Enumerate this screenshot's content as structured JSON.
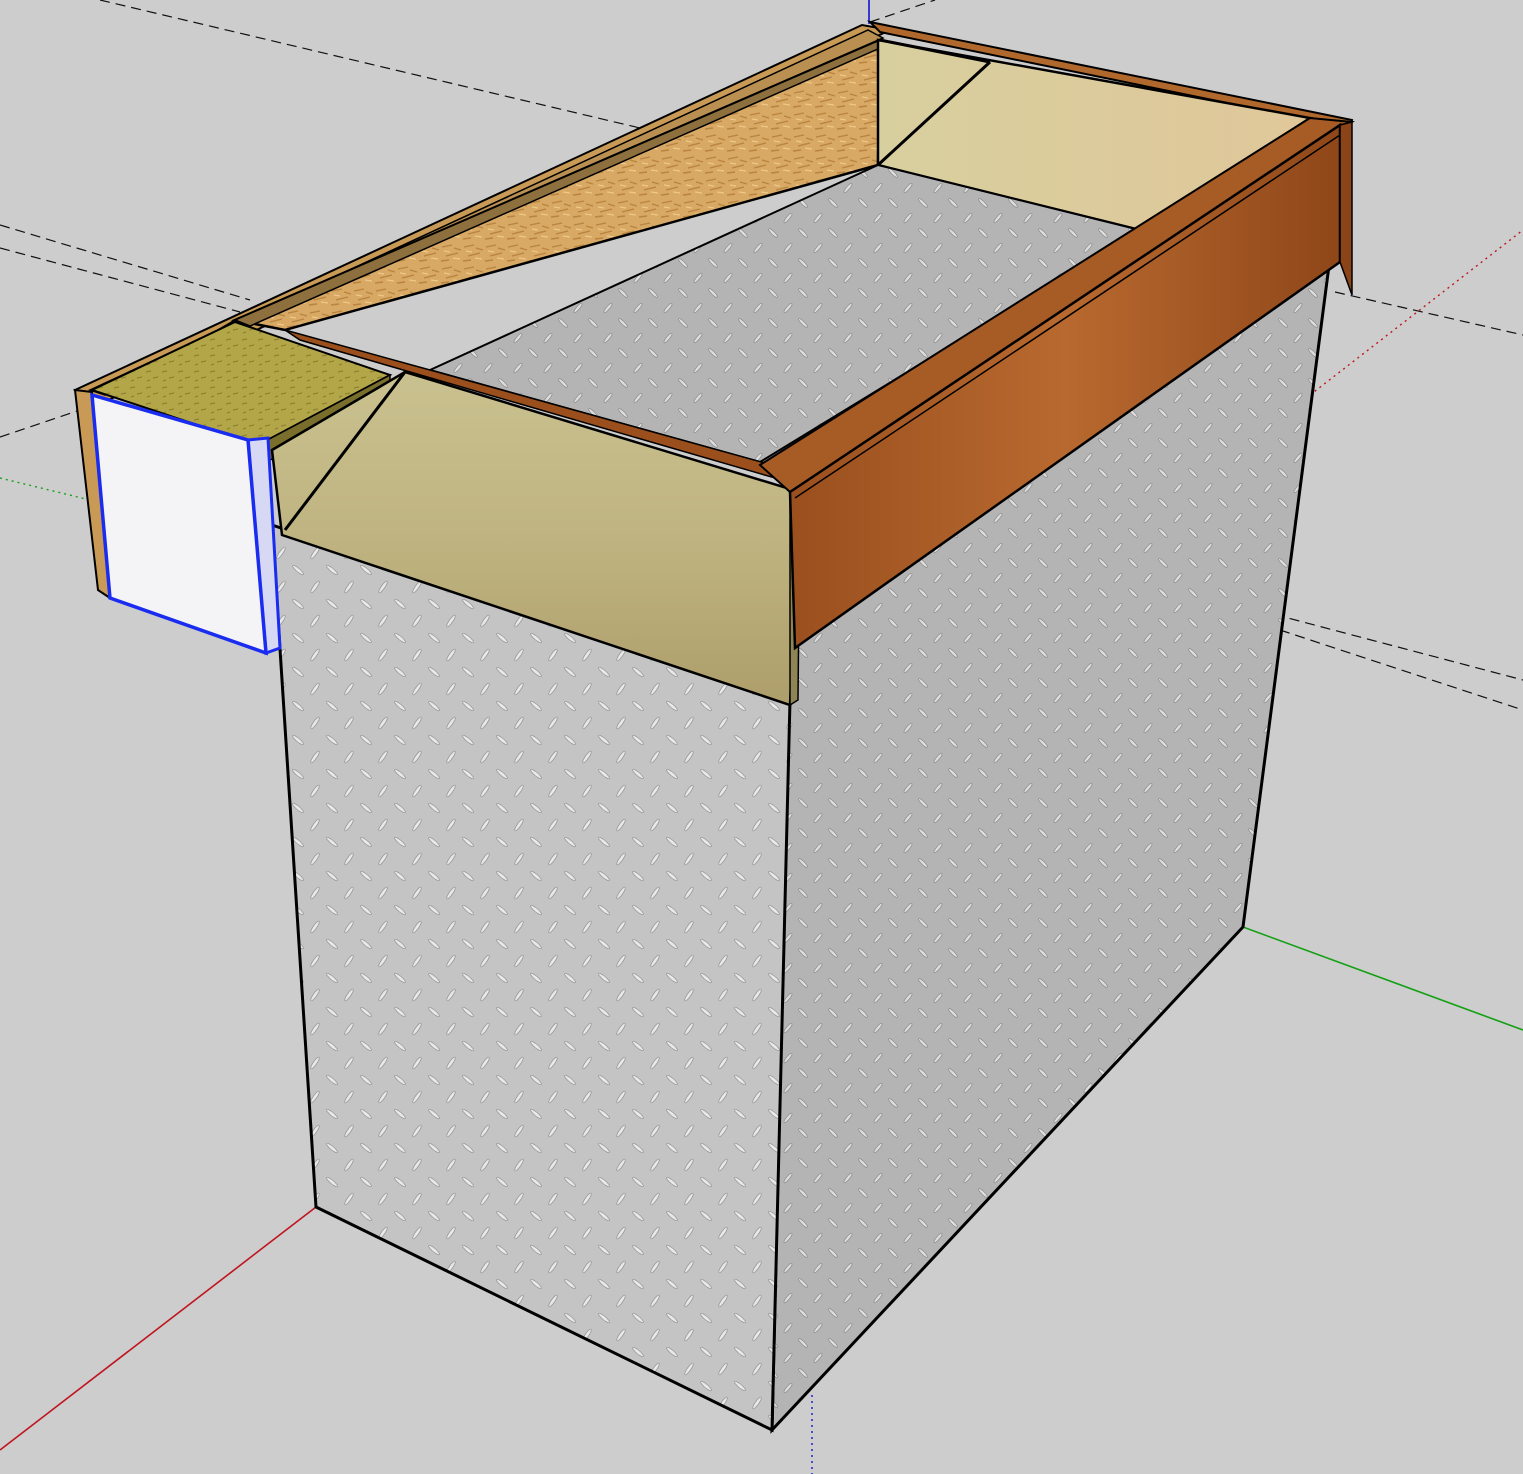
{
  "scene": {
    "background": "#cdcdcd",
    "axis_colors": {
      "red": "#c0141e",
      "green": "#14a014",
      "blue": "#1414d2"
    },
    "materials": {
      "diamond_plate": "#bdbdbd",
      "osb_board": "#d9a85e",
      "pine_face": "#cbbf92",
      "mahogany_trim": "#a85c25",
      "olive_board": "#b7a84a",
      "selected_face": "#f4f4f6",
      "selection_edge": "#1a2cf0"
    }
  }
}
